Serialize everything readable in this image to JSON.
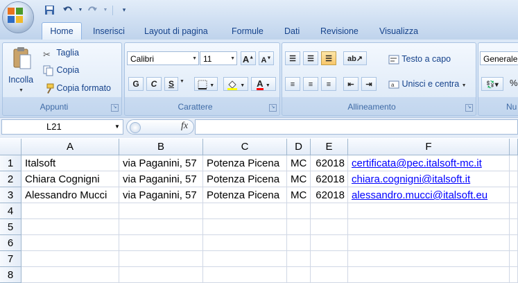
{
  "quick_access": {
    "save": "save-icon",
    "undo": "undo-icon",
    "redo": "redo-icon",
    "customize": "customize-icon"
  },
  "tabs": [
    "Home",
    "Inserisci",
    "Layout di pagina",
    "Formule",
    "Dati",
    "Revisione",
    "Visualizza"
  ],
  "ribbon": {
    "appunti": {
      "label": "Appunti",
      "paste": "Incolla",
      "cut": "Taglia",
      "copy": "Copia",
      "format_painter": "Copia formato"
    },
    "carattere": {
      "label": "Carattere",
      "font": "Calibri",
      "size": "11",
      "bold": "G",
      "italic": "C",
      "underline": "S"
    },
    "allineamento": {
      "label": "Allineamento",
      "wrap": "Testo a capo",
      "merge": "Unisci e centra"
    },
    "numeri": {
      "label": "Nu",
      "format": "Generale",
      "percent": "%"
    }
  },
  "name_box": "L21",
  "fx": "fx",
  "columns": [
    "A",
    "B",
    "C",
    "D",
    "E",
    "F"
  ],
  "rows": [
    {
      "n": "1",
      "cells": [
        "Italsoft",
        "via Paganini, 57",
        "Potenza Picena",
        "MC",
        "62018",
        "certificata@pec.italsoft-mc.it"
      ]
    },
    {
      "n": "2",
      "cells": [
        "Chiara Cognigni",
        "via Paganini, 57",
        "Potenza Picena",
        "MC",
        "62018",
        "chiara.cognigni@italsoft.it"
      ]
    },
    {
      "n": "3",
      "cells": [
        "Alessandro Mucci",
        "via Paganini, 57",
        "Potenza Picena",
        "MC",
        "62018",
        "alessandro.mucci@italsoft.eu"
      ]
    },
    {
      "n": "4",
      "cells": [
        "",
        "",
        "",
        "",
        "",
        ""
      ]
    },
    {
      "n": "5",
      "cells": [
        "",
        "",
        "",
        "",
        "",
        ""
      ]
    },
    {
      "n": "6",
      "cells": [
        "",
        "",
        "",
        "",
        "",
        ""
      ]
    },
    {
      "n": "7",
      "cells": [
        "",
        "",
        "",
        "",
        "",
        ""
      ]
    },
    {
      "n": "8",
      "cells": [
        "",
        "",
        "",
        "",
        "",
        ""
      ]
    }
  ],
  "colors": {
    "accent": "#15428b",
    "link": "#0000ff",
    "font_color_bar": "#ff0000",
    "highlight_bar": "#ffff00"
  }
}
